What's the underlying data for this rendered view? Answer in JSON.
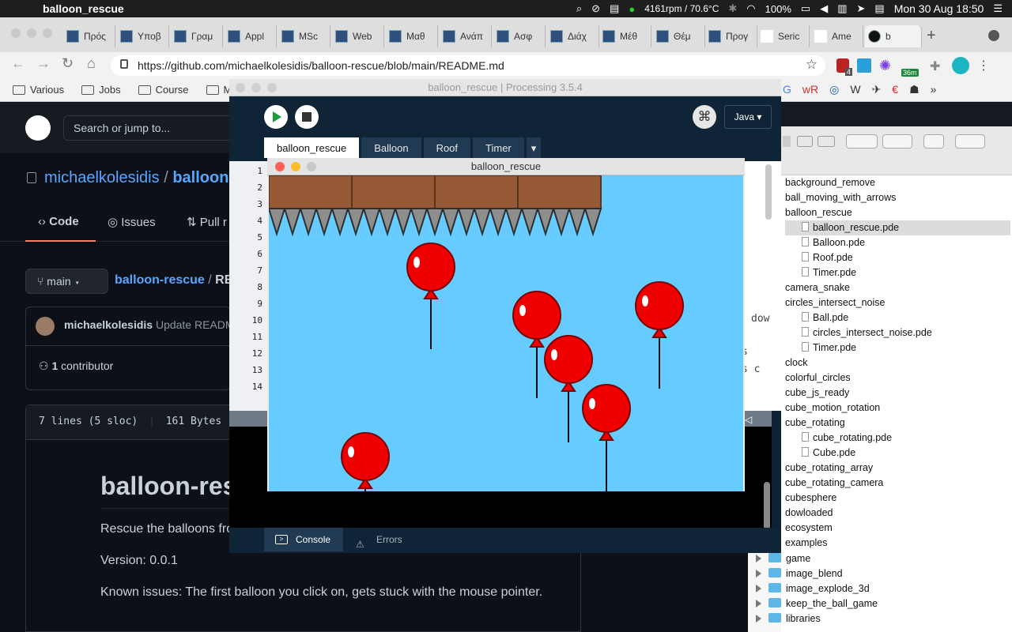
{
  "menubar": {
    "app_name": "balloon_rescue",
    "cpu": "4161rpm / 70.6°C",
    "battery": "100%",
    "datetime": "Mon 30 Aug  18:50"
  },
  "chrome": {
    "tabs": [
      "Πρός",
      "Υποβ",
      "Γραμ",
      "Appl",
      "MSc",
      "Web",
      "Μαθ",
      "Ανάπ",
      "Ασφ",
      "Διάχ",
      "Μέθ",
      "Θέμ",
      "Προγ",
      "Seric",
      "Ame",
      "b"
    ],
    "url": "https://github.com/michaelkolesidis/balloon-rescue/blob/main/README.md",
    "bookmarks": [
      "Various",
      "Jobs",
      "Course",
      "MA"
    ],
    "ext_badge_1": "4",
    "ext_badge_2": "36m"
  },
  "github": {
    "search_placeholder": "Search or jump to...",
    "owner": "michaelkolesidis",
    "separator": "/",
    "repo_short": "balloon-",
    "nav": {
      "code": "Code",
      "issues": "Issues",
      "pulls": "Pull r"
    },
    "branch": "main",
    "path_repo": "balloon-rescue",
    "path_sep": "/",
    "path_file": "RE",
    "commit_author": "michaelkolesidis",
    "commit_msg": "Update READM",
    "contributors_count": "1",
    "contributors_label": "contributor",
    "file_lines": "7 lines (5 sloc)",
    "file_size": "161 Bytes",
    "readme_title": "balloon-res",
    "readme_p1": "Rescue the balloons fro",
    "readme_version": "Version: 0.0.1",
    "readme_issues": "Known issues: The first balloon you click on, gets stuck with the mouse pointer."
  },
  "finder": {
    "rows": [
      {
        "name": "background_remove",
        "child": false
      },
      {
        "name": "ball_moving_with_arrows",
        "child": false
      },
      {
        "name": "balloon_rescue",
        "child": false
      },
      {
        "name": "balloon_rescue.pde",
        "child": true,
        "selected": true
      },
      {
        "name": "Balloon.pde",
        "child": true
      },
      {
        "name": "Roof.pde",
        "child": true
      },
      {
        "name": "Timer.pde",
        "child": true
      },
      {
        "name": "camera_snake",
        "child": false
      },
      {
        "name": "circles_intersect_noise",
        "child": false
      },
      {
        "name": "Ball.pde",
        "child": true
      },
      {
        "name": "circles_intersect_noise.pde",
        "child": true
      },
      {
        "name": "Timer.pde",
        "child": true
      },
      {
        "name": "clock",
        "child": false
      },
      {
        "name": "colorful_circles",
        "child": false
      },
      {
        "name": "cube_js_ready",
        "child": false
      },
      {
        "name": "cube_motion_rotation",
        "child": false
      },
      {
        "name": "cube_rotating",
        "child": false
      },
      {
        "name": "cube_rotating.pde",
        "child": true
      },
      {
        "name": "Cube.pde",
        "child": true
      },
      {
        "name": "cube_rotating_array",
        "child": false
      },
      {
        "name": "cube_rotating_camera",
        "child": false
      },
      {
        "name": "cubesphere",
        "child": false
      },
      {
        "name": "dowloaded",
        "child": false
      },
      {
        "name": "ecosystem",
        "child": false
      },
      {
        "name": "examples",
        "child": false
      }
    ],
    "folders": [
      "game",
      "image_blend",
      "image_explode_3d",
      "keep_the_ball_game",
      "libraries"
    ],
    "editor_fragment_1": "dow",
    "editor_fragment_2": "s",
    "editor_fragment_3": "s c"
  },
  "processing": {
    "title": "balloon_rescue | Processing 3.5.4",
    "mode": "Java ▾",
    "tabs": [
      "balloon_rescue",
      "Balloon",
      "Roof",
      "Timer"
    ],
    "tab_menu": "▾",
    "line_numbers": [
      "1",
      "2",
      "3",
      "4",
      "5",
      "6",
      "7",
      "8",
      "9",
      "10",
      "11",
      "12",
      "13",
      "14"
    ],
    "console_tab": "Console",
    "errors_tab": "Errors"
  },
  "sketch": {
    "title": "balloon_rescue",
    "sky_color": "#66ccff",
    "brick_color": "#955a35",
    "balloon_color": "#ee0000"
  }
}
